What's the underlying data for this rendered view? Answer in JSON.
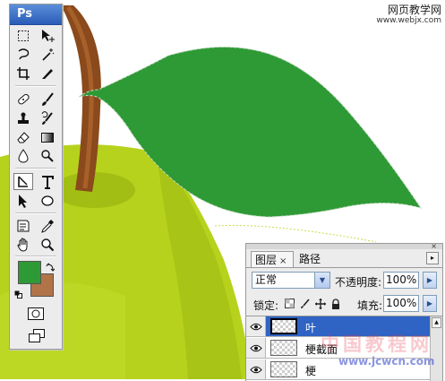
{
  "app": {
    "logo": "Ps"
  },
  "watermark_top": {
    "line1": "网页教学网",
    "line2": "www.webjx.com"
  },
  "watermark_bottom": {
    "line1": "中国教程网",
    "line2": "www.jcwcn.com"
  },
  "colors": {
    "foreground": "#2e9a35",
    "background": "#b07448",
    "leaf": "#2e9a35",
    "apple_light": "#b7d21c",
    "apple_dark": "#9cbf14",
    "stem": "#8a4a1c",
    "selection_highlight": "#2f63c4"
  },
  "tools": [
    "rectangular-marquee-icon",
    "move-icon",
    "lasso-icon",
    "magic-wand-icon",
    "crop-icon",
    "slice-icon",
    "healing-brush-icon",
    "brush-icon",
    "clone-stamp-icon",
    "history-brush-icon",
    "eraser-icon",
    "gradient-icon",
    "blur-icon",
    "dodge-icon",
    "pen-icon",
    "type-icon",
    "path-selection-icon",
    "ellipse-icon",
    "notes-icon",
    "eyedropper-icon",
    "hand-icon",
    "zoom-icon"
  ],
  "layers_panel": {
    "tabs": [
      {
        "label": "图层",
        "active": true
      },
      {
        "label": "路径",
        "active": false
      }
    ],
    "tab_close": "×",
    "blend_mode": "正常",
    "opacity_label": "不透明度:",
    "opacity_value": "100%",
    "lock_label": "锁定:",
    "fill_label": "填充:",
    "fill_value": "100%",
    "layers": [
      {
        "name": "叶",
        "visible": true,
        "selected": true
      },
      {
        "name": "梗截面",
        "visible": true,
        "selected": false
      },
      {
        "name": "梗",
        "visible": true,
        "selected": false
      }
    ]
  }
}
